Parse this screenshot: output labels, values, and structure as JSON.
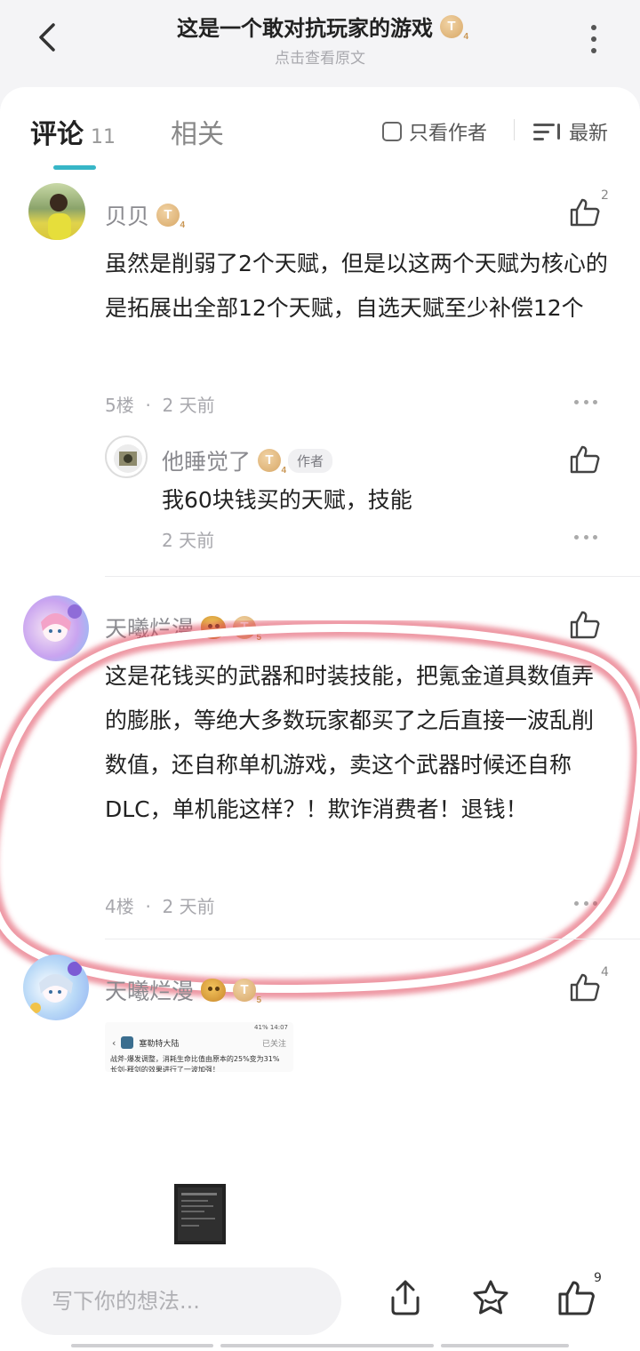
{
  "header": {
    "title": "这是一个敢对抗玩家的游戏",
    "subtitle": "点击查看原文",
    "title_badge": "T",
    "title_badge_level": "4"
  },
  "tabs": {
    "comments_label": "评论",
    "comments_count": "11",
    "related_label": "相关",
    "author_only_label": "只看作者",
    "sort_label": "最新"
  },
  "comments": [
    {
      "name": "贝贝",
      "badge": "T",
      "badge_level": "4",
      "text": "虽然是削弱了2个天赋，但是以这两个天赋为核心的是拓展出全部12个天赋，自选天赋至少补偿12个",
      "floor": "5楼",
      "separator": "·",
      "time": "2 天前",
      "likes": "2",
      "reply": {
        "name": "他睡觉了",
        "badge": "T",
        "badge_level": "4",
        "author_tag": "作者",
        "text": "我60块钱买的天赋，技能",
        "time": "2 天前"
      }
    },
    {
      "name": "天曦烂漫",
      "badge": "T",
      "badge_level": "5",
      "text": "这是花钱买的武器和时装技能，把氪金道具数值弄的膨胀，等绝大多数玩家都买了之后直接一波乱削数值，还自称单机游戏，卖这个武器时候还自称DLC，单机能这样？！欺诈消费者！退钱！",
      "floor": "4楼",
      "separator": "·",
      "time": "2 天前"
    },
    {
      "name": "天曦烂漫",
      "badge": "T",
      "badge_level": "5",
      "likes": "4",
      "embedded": {
        "status": "41% 14:07",
        "app_title": "塞勒特大陆",
        "follow": "已关注",
        "line1": "战斧-爆发调整，消耗生命比值由原本的25%变为31%",
        "line2": "长剑-释剑的效果进行了一波加强！"
      }
    }
  ],
  "bottom_bar": {
    "input_placeholder": "写下你的想法...",
    "like_count": "9"
  },
  "colors": {
    "accent": "#37b6c7",
    "highlight_ring": "#e0435a"
  }
}
